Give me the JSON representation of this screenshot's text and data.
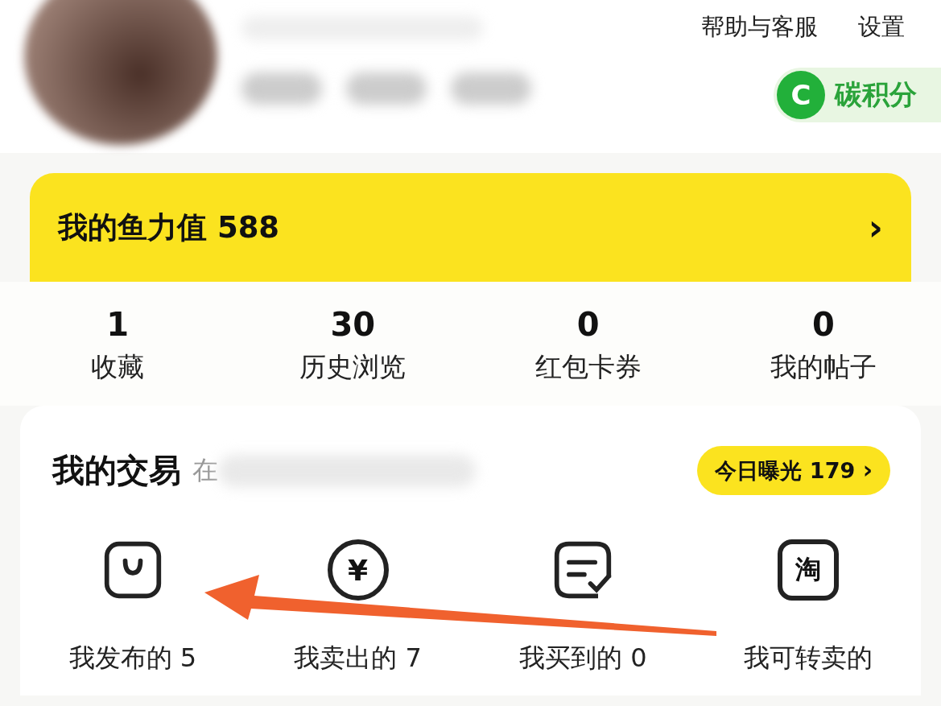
{
  "header": {
    "links": [
      "帮助与客服",
      "设置"
    ],
    "carbon": {
      "badge": "C",
      "label": "碳积分"
    }
  },
  "fish_points": {
    "label": "我的鱼力值",
    "value": "588",
    "chevron": "›"
  },
  "stats": [
    {
      "value": "1",
      "label": "收藏"
    },
    {
      "value": "30",
      "label": "历史浏览"
    },
    {
      "value": "0",
      "label": "红包卡券"
    },
    {
      "value": "0",
      "label": "我的帖子"
    }
  ],
  "trades": {
    "title": "我的交易",
    "subtitle": "在",
    "exposure": {
      "label": "今日曝光 179",
      "chevron": "›"
    },
    "items": [
      {
        "kind": "bag",
        "label": "我发布的 5"
      },
      {
        "kind": "coin",
        "glyph": "¥",
        "label": "我卖出的 7"
      },
      {
        "kind": "note",
        "label": "我买到的 0"
      },
      {
        "kind": "tao",
        "glyph": "淘",
        "label": "我可转卖的"
      }
    ]
  },
  "annotation": {
    "kind": "arrow"
  }
}
